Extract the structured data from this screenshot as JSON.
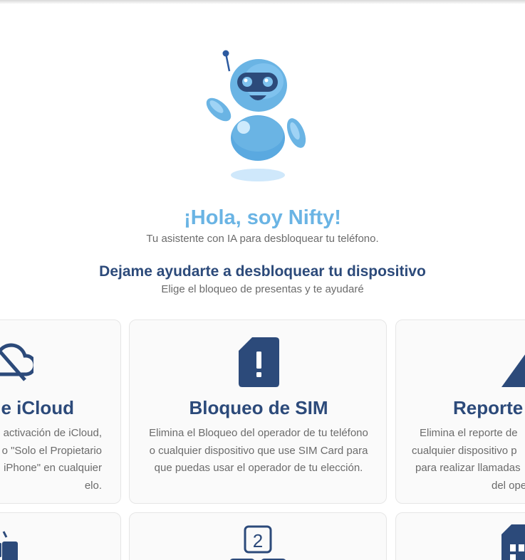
{
  "assistant": {
    "greeting": "¡Hola, soy Nifty!",
    "tagline": "Tu asistente con IA para desbloquear tu teléfono."
  },
  "section": {
    "title": "Dejame ayudarte a desbloquear tu dispositivo",
    "subtitle": "Elige el bloqueo de presentas y te ayudaré"
  },
  "cards": [
    {
      "title": "e iCloud",
      "icon": "cloud-off-icon",
      "desc": [
        "activación de iCloud,",
        "o \"Solo el Propietario",
        "iPhone\" en cualquier",
        "elo."
      ]
    },
    {
      "title": "Bloqueo de SIM",
      "icon": "sim-alert-icon",
      "desc": [
        "Elimina el Bloqueo del operador de tu teléfono",
        "o cualquier dispositivo que use SIM Card para",
        "que puedas usar el operador de tu elección."
      ]
    },
    {
      "title": "Reporte",
      "icon": "warning-icon",
      "desc": [
        "Elimina el reporte de",
        "cualquier dispositivo p",
        "para realizar llamadas",
        "del ope"
      ]
    }
  ],
  "row2_icons": [
    "android-icon",
    "keypad-icon",
    "sim-grid-icon"
  ],
  "row2_keypad_digit": "2",
  "colors": {
    "accent": "#6ab4e4",
    "navy": "#2c4a7a",
    "text_muted": "#6b6b6b",
    "card_bg": "#fafafa"
  }
}
